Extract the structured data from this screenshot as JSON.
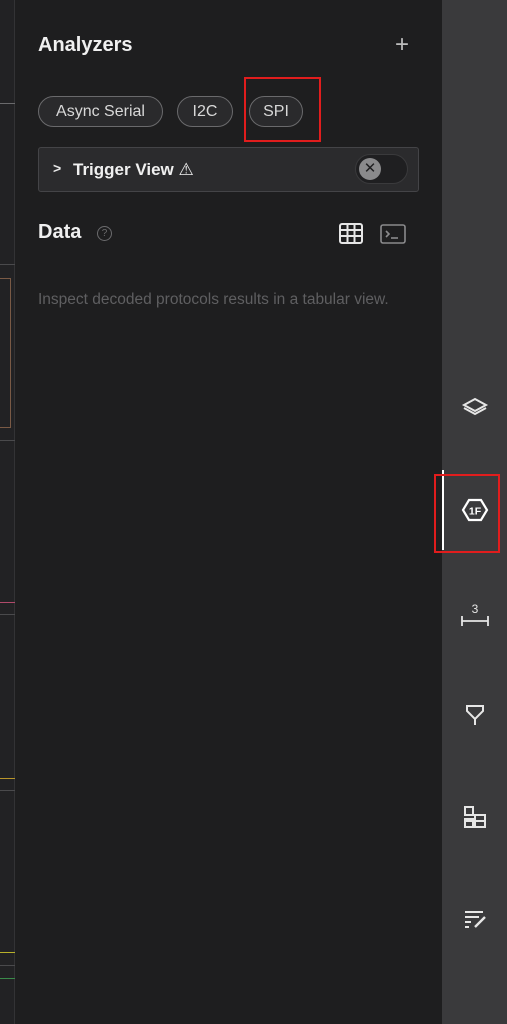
{
  "analyzers": {
    "title": "Analyzers",
    "add_label": "+",
    "chips": [
      "Async Serial",
      "I2C",
      "SPI"
    ]
  },
  "trigger": {
    "chevron": ">",
    "label": "Trigger View ⚠",
    "toggle_knob": "✕"
  },
  "data": {
    "title": "Data",
    "help": "?",
    "description": "Inspect decoded protocols results in a tabular view."
  },
  "sidebar": {
    "icons": [
      "layers-icon",
      "protocol-1f-icon",
      "measurement-icon",
      "trigger-icon",
      "extensions-icon",
      "notes-icon"
    ],
    "measurement_badge": "3",
    "active": "protocol-1f-icon"
  },
  "colors": {
    "highlight": "#e11d1d",
    "panel_bg": "#1e1e1f",
    "sidebar_bg": "#3a3a3c"
  }
}
